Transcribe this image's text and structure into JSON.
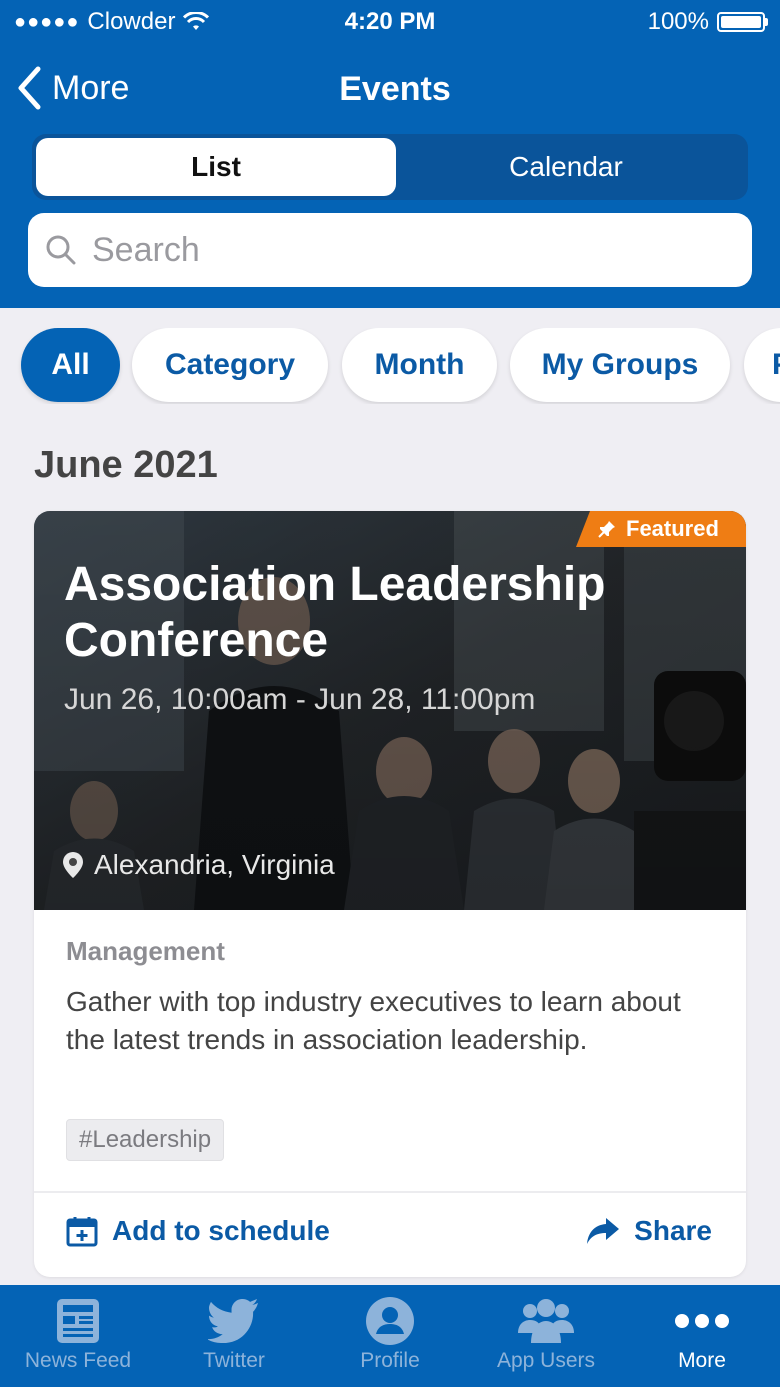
{
  "status_bar": {
    "signal": "●●●●●",
    "carrier": "Clowder",
    "time": "4:20 PM",
    "battery": "100%"
  },
  "nav": {
    "back_label": "More",
    "title": "Events"
  },
  "segments": {
    "list": "List",
    "calendar": "Calendar"
  },
  "search": {
    "placeholder": "Search"
  },
  "filters": [
    "All",
    "Category",
    "Month",
    "My Groups",
    "P"
  ],
  "section": {
    "title": "June 2021"
  },
  "event": {
    "badge": "Featured",
    "title": "Association Leadership Conference",
    "date": "Jun 26, 10:00am - Jun 28, 11:00pm",
    "location": "Alexandria, Virginia",
    "category": "Management",
    "description": "Gather with top industry executives to learn about the latest trends in association leadership.",
    "tag": "#Leadership",
    "add_label": "Add to schedule",
    "share_label": "Share"
  },
  "tabbar": [
    {
      "label": "News Feed",
      "icon": "news-feed-icon"
    },
    {
      "label": "Twitter",
      "icon": "twitter-icon"
    },
    {
      "label": "Profile",
      "icon": "profile-icon"
    },
    {
      "label": "App Users",
      "icon": "app-users-icon"
    },
    {
      "label": "More",
      "icon": "more-icon"
    }
  ],
  "colors": {
    "brand": "#0463b5",
    "featured": "#ef7d14",
    "link": "#0b5aa5"
  }
}
